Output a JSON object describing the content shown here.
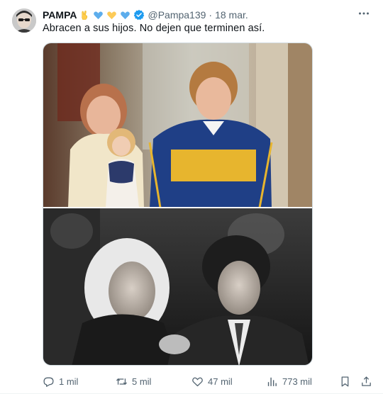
{
  "tweet": {
    "author_name": "PAMPA",
    "handle": "@Pampa139",
    "separator": "·",
    "date": "18 mar.",
    "text": "Abracen a sus hijos. No dejen que terminen así.",
    "verified_color": "#1d9bf0",
    "emojis": [
      "victory-hand-emoji",
      "blue-heart-emoji",
      "yellow-heart-emoji",
      "blue-heart-emoji"
    ]
  },
  "metrics": {
    "replies": "1 mil",
    "reposts": "5 mil",
    "likes": "47 mil",
    "views": "773 mil"
  },
  "colors": {
    "text_primary": "#0f1419",
    "text_secondary": "#536471",
    "border": "#cfd9de"
  }
}
